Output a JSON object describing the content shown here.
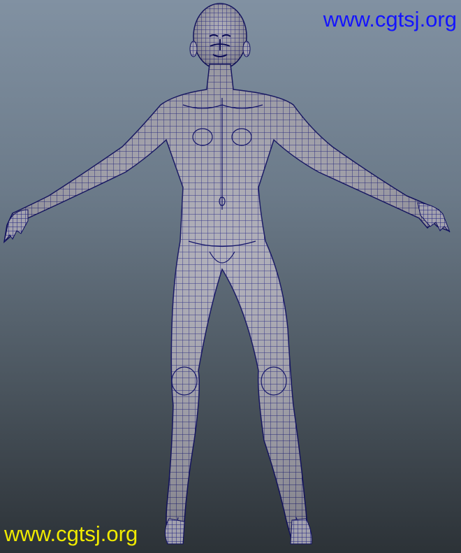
{
  "viewport": {
    "background_top": "#8191a2",
    "background_bottom": "#2c3237",
    "model_fill": "#a7a6b1",
    "wire_color": "#1e1f7e",
    "outline_color": "#101060"
  },
  "watermarks": {
    "top_text": "www.cgtsj.org",
    "top_color": "#1414ff",
    "bottom_text": "www.cgtsj.org",
    "bottom_color": "#f0ea00"
  }
}
